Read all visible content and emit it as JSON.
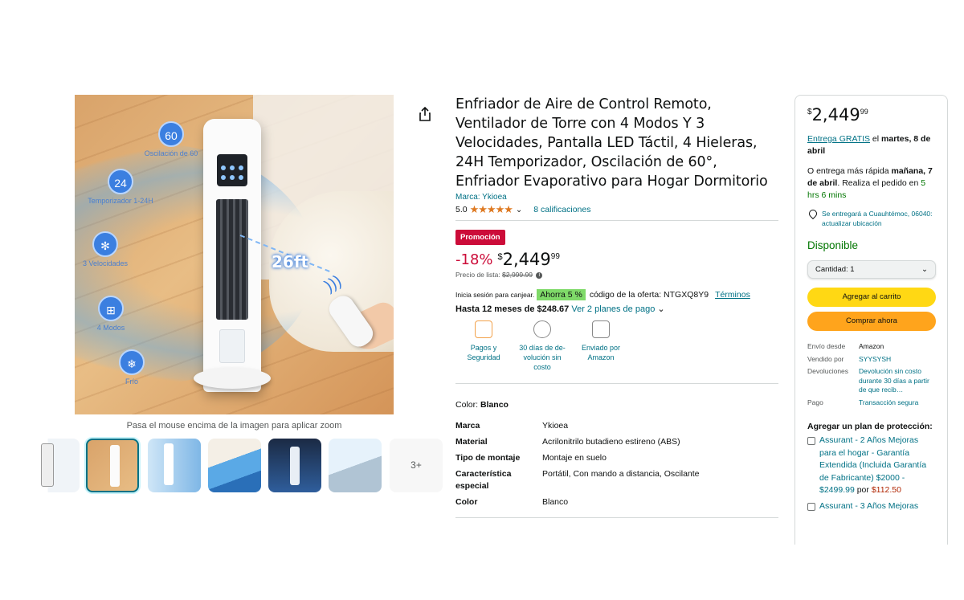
{
  "gallery": {
    "features": [
      {
        "icon": "60",
        "label": "Oscilación de 60"
      },
      {
        "icon": "24",
        "label": "Temporizador 1-24H"
      },
      {
        "icon": "✻",
        "label": "3 Velocidades"
      },
      {
        "icon": "⊞",
        "label": "4 Modos"
      },
      {
        "icon": "❄",
        "label": "Frío"
      }
    ],
    "distance_label": "26ft",
    "zoom_hint": "Pasa el mouse encima de la imagen para aplicar zoom",
    "more_label": "3+"
  },
  "product": {
    "title": "Enfriador de Aire de Control Remoto, Ventilador de Torre con 4 Modos Y 3 Velocidades, Pantalla LED Táctil, 4 Hieleras, 24H Temporizador, Oscilación de 60°, Enfriador Evaporativo para Hogar Dormitorio",
    "brand": "Marca: Ykioea",
    "rating": "5.0",
    "stars": "★★★★★",
    "ratings_count": "8 calificaciones",
    "promo_badge": "Promoción",
    "discount": "-18%",
    "price_symbol": "$",
    "price_whole": "2,449",
    "price_fraction": "99",
    "list_price_label": "Precio de lista:",
    "list_price": "$2,999.99",
    "coupon_signin": "Inicia sesión para canjear.",
    "coupon_save": "Ahorra 5 %",
    "coupon_code": "código de la oferta: NTGXQ8Y9",
    "coupon_terms": "Términos",
    "installments_bold": "Hasta 12 meses de $248.67",
    "installments_link": "Ver 2 planes de pago",
    "badges": [
      {
        "icon": "lock-icon",
        "label": "Pagos y Seguridad"
      },
      {
        "icon": "return-icon",
        "label": "30 días de de-volución sin costo"
      },
      {
        "icon": "truck-icon",
        "label": "Enviado por Amazon"
      }
    ],
    "color_label": "Color:",
    "color_value": "Blanco",
    "specs": [
      {
        "key": "Marca",
        "value": "Ykioea"
      },
      {
        "key": "Material",
        "value": "Acrilonitrilo butadieno estireno (ABS)"
      },
      {
        "key": "Tipo de montaje",
        "value": "Montaje en suelo"
      },
      {
        "key": "Característica especial",
        "value": "Portátil, Con mando a distancia, Oscilante"
      },
      {
        "key": "Color",
        "value": "Blanco"
      }
    ]
  },
  "buybox": {
    "price_symbol": "$",
    "price_whole": "2,449",
    "price_fraction": "99",
    "delivery_link": "Entrega GRATIS",
    "delivery_rest": " el ",
    "delivery_date": "martes, 8 de abril",
    "fast_prefix": "O entrega más rápida ",
    "fast_date": "mañana, 7 de abril",
    "fast_mid": ". Realiza el pedido en ",
    "fast_time": "5 hrs 6 mins",
    "location": "Se entregará a Cuauhtémoc, 06040: actualizar ubicación",
    "stock": "Disponible",
    "quantity": "Cantidad: 1",
    "add_to_cart": "Agregar al carrito",
    "buy_now": "Comprar ahora",
    "details": [
      {
        "key": "Envío desde",
        "value": "Amazon",
        "link": false
      },
      {
        "key": "Vendido por",
        "value": "SYYSYSH",
        "link": true
      },
      {
        "key": "Devoluciones",
        "value": "Devolución sin costo durante 30 días a partir de que recib…",
        "link": true
      },
      {
        "key": "Pago",
        "value": "Transacción segura",
        "link": true
      }
    ],
    "protection_title": "Agregar un plan de protección:",
    "protection_plans": [
      {
        "text": "Assurant - 2 Años Mejoras para el hogar - Garantía Extendida (Incluida Garantía de Fabricante) $2000 - $2499.99",
        "por": " por ",
        "price": "$112.50"
      },
      {
        "text": "Assurant - 3 Años Mejoras",
        "por": "",
        "price": ""
      }
    ]
  },
  "colors": {
    "link": "#007185",
    "deal_red": "#cc0c39",
    "cart_yellow": "#ffd814",
    "buy_orange": "#ffa41c",
    "in_stock_green": "#007600"
  }
}
